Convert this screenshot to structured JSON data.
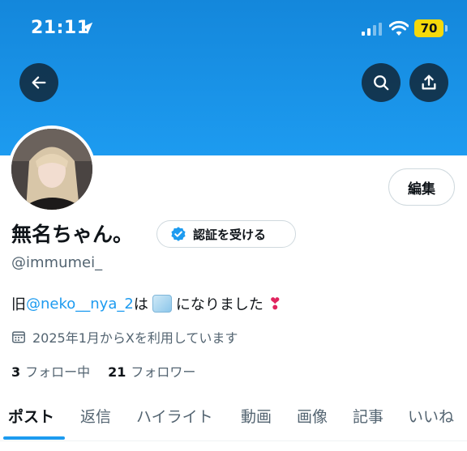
{
  "status_bar": {
    "time": "21:11",
    "battery": "70"
  },
  "profile": {
    "display_name": "無名ちゃん。",
    "handle": "@immumei_",
    "edit_label": "編集",
    "verify_label": "認証を受ける",
    "bio": {
      "prefix": "旧",
      "mention": "@neko__nya_2",
      "middle": "は",
      "suffix": "になりました"
    },
    "joined": "2025年1月からXを利用しています",
    "following_count": "3",
    "following_label": "フォロー中",
    "followers_count": "21",
    "followers_label": "フォロワー"
  },
  "tabs": [
    "ポスト",
    "返信",
    "ハイライト",
    "動画",
    "画像",
    "記事",
    "いいね"
  ],
  "colors": {
    "accent": "#1d9bf0",
    "banner": "#1d9bf0",
    "battery": "#f5d90a"
  }
}
